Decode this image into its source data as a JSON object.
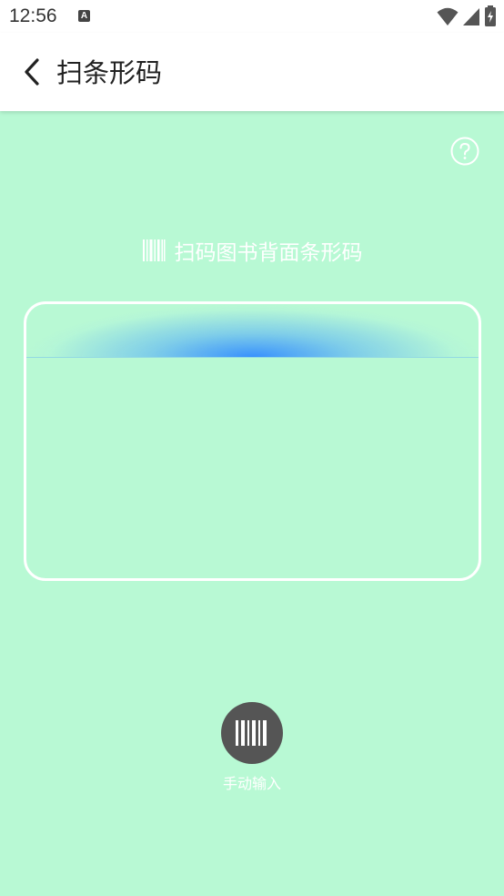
{
  "status_bar": {
    "time": "12:56",
    "notification_icon_letter": "A",
    "icons": [
      "wifi-icon",
      "cellular-signal-icon",
      "battery-charging-icon"
    ]
  },
  "app_bar": {
    "back_icon": "back-arrow-icon",
    "title": "扫条形码"
  },
  "scanner": {
    "help_icon": "help-circle-icon",
    "hint_icon": "barcode-icon",
    "hint_text": "扫码图书背面条形码",
    "scan_line_color": "#3b8cff"
  },
  "manual_input": {
    "icon": "barcode-icon",
    "label": "手动输入"
  },
  "colors": {
    "background": "#b8f9d4",
    "frame": "#ffffff",
    "manual_button": "#555555"
  }
}
